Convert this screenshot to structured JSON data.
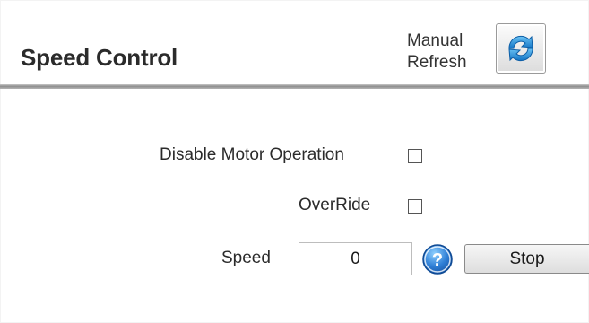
{
  "header": {
    "title": "Speed Control",
    "manual_refresh_label": "Manual Refresh",
    "refresh_icon": "refresh-icon"
  },
  "controls": {
    "disable_motor_label": "Disable Motor Operation",
    "disable_motor_checked": false,
    "override_label": "OverRide",
    "override_checked": false,
    "speed_label": "Speed",
    "speed_value": "0",
    "help_icon": "help-icon",
    "stop_label": "Stop"
  },
  "colors": {
    "help_blue": "#2f7fd6",
    "refresh_blue": "#1f8fd9",
    "divider_gray": "#8f8f8f"
  }
}
